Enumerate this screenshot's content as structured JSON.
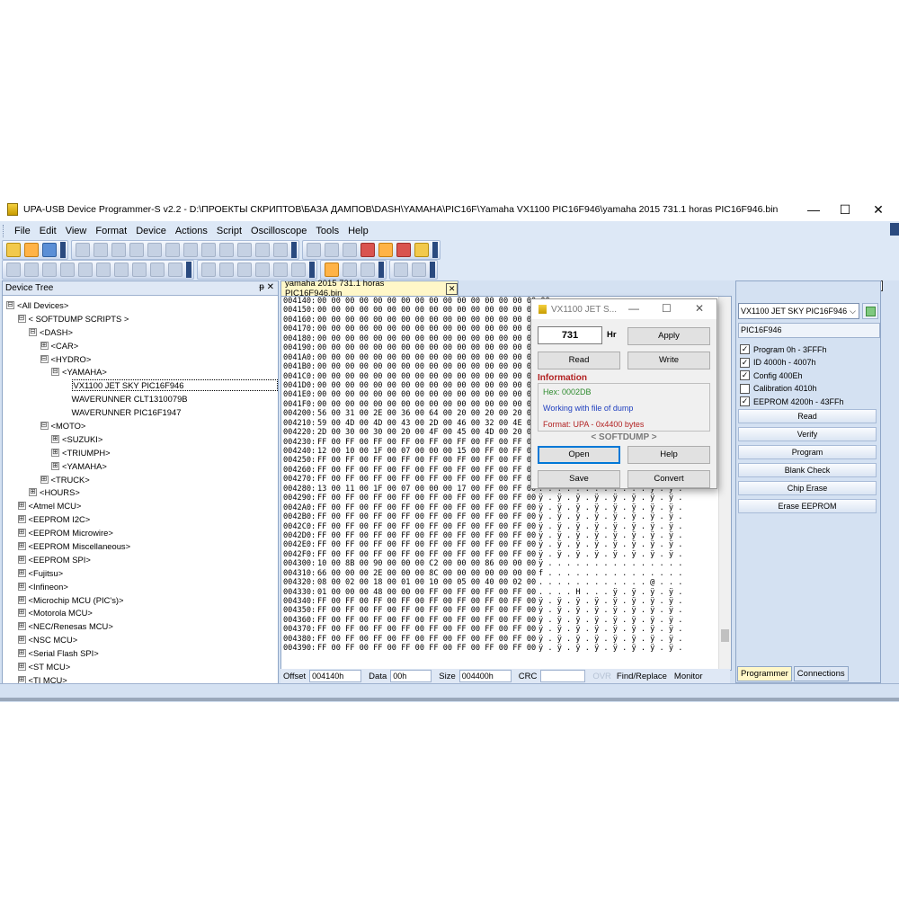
{
  "window": {
    "title": "UPA-USB Device Programmer-S v2.2 - D:\\ПРОЕКТЫ СКРИПТОВ\\БАЗА ДАМПОВ\\DASH\\YAMAHA\\PIC16F\\Yamaha VX1100 PIC16F946\\yamaha 2015 731.1 horas PIC16F946.bin",
    "minimize": "—",
    "maximize": "☐",
    "close": "✕"
  },
  "menu": [
    "File",
    "Edit",
    "View",
    "Format",
    "Device",
    "Actions",
    "Script",
    "Oscilloscope",
    "Tools",
    "Help"
  ],
  "device_tree": {
    "header": "Device Tree",
    "header_buttons": "ᵽ ✕",
    "nodes": [
      {
        "indent": 0,
        "exp": "⊟",
        "label": "<All Devices>"
      },
      {
        "indent": 1,
        "exp": "⊟",
        "label": "< SOFTDUMP SCRIPTS >"
      },
      {
        "indent": 2,
        "exp": "⊟",
        "label": "<DASH>"
      },
      {
        "indent": 3,
        "exp": "⊞",
        "label": "<CAR>"
      },
      {
        "indent": 3,
        "exp": "⊟",
        "label": "<HYDRO>"
      },
      {
        "indent": 4,
        "exp": "⊟",
        "label": "<YAMAHA>"
      },
      {
        "indent": 5,
        "exp": "",
        "label": "VX1100 JET SKY PIC16F946",
        "selected": true
      },
      {
        "indent": 5,
        "exp": "",
        "label": "WAVERUNNER CLT1310079B"
      },
      {
        "indent": 5,
        "exp": "",
        "label": "WAVERUNNER PIC16F1947"
      },
      {
        "indent": 3,
        "exp": "⊟",
        "label": "<MOTO>"
      },
      {
        "indent": 4,
        "exp": "⊞",
        "label": "<SUZUKI>"
      },
      {
        "indent": 4,
        "exp": "⊞",
        "label": "<TRIUMPH>"
      },
      {
        "indent": 4,
        "exp": "⊞",
        "label": "<YAMAHA>"
      },
      {
        "indent": 3,
        "exp": "⊞",
        "label": "<TRUCK>"
      },
      {
        "indent": 2,
        "exp": "⊞",
        "label": "<HOURS>"
      },
      {
        "indent": 1,
        "exp": "⊞",
        "label": "<Atmel MCU>"
      },
      {
        "indent": 1,
        "exp": "⊞",
        "label": "<EEPROM I2C>"
      },
      {
        "indent": 1,
        "exp": "⊞",
        "label": "<EEPROM Microwire>"
      },
      {
        "indent": 1,
        "exp": "⊞",
        "label": "<EEPROM Miscellaneous>"
      },
      {
        "indent": 1,
        "exp": "⊞",
        "label": "<EEPROM SPI>"
      },
      {
        "indent": 1,
        "exp": "⊞",
        "label": "<Fujitsu>"
      },
      {
        "indent": 1,
        "exp": "⊞",
        "label": "<Infineon>"
      },
      {
        "indent": 1,
        "exp": "⊞",
        "label": "<Microchip MCU (PIC's)>"
      },
      {
        "indent": 1,
        "exp": "⊞",
        "label": "<Motorola MCU>"
      },
      {
        "indent": 1,
        "exp": "⊞",
        "label": "<NEC/Renesas MCU>"
      },
      {
        "indent": 1,
        "exp": "⊞",
        "label": "<NSC MCU>"
      },
      {
        "indent": 1,
        "exp": "⊞",
        "label": "<Serial Flash SPI>"
      },
      {
        "indent": 1,
        "exp": "⊞",
        "label": "<ST MCU>"
      },
      {
        "indent": 1,
        "exp": "⊞",
        "label": "<TI MCU>"
      }
    ]
  },
  "editor": {
    "tab": "yamaha 2015 731.1 horas PIC16F946.bin",
    "tab_close": "✕",
    "rows": [
      {
        "addr": "004140:",
        "hex": "00 00 00 00 00 00 00 00 00 00 00 00 00 00 00 00 00",
        "ascii": ""
      },
      {
        "addr": "004150:",
        "hex": "00 00 00 00 00 00 00 00 00 00 00 00 00 00 00 00 00",
        "ascii": ""
      },
      {
        "addr": "004160:",
        "hex": "00 00 00 00 00 00 00 00 00 00 00 00 00 00 00 00 00",
        "ascii": ""
      },
      {
        "addr": "004170:",
        "hex": "00 00 00 00 00 00 00 00 00 00 00 00 00 00 00 00 00",
        "ascii": ""
      },
      {
        "addr": "004180:",
        "hex": "00 00 00 00 00 00 00 00 00 00 00 00 00 00 00 00 00",
        "ascii": ""
      },
      {
        "addr": "004190:",
        "hex": "00 00 00 00 00 00 00 00 00 00 00 00 00 00 00 00 00",
        "ascii": ""
      },
      {
        "addr": "0041A0:",
        "hex": "00 00 00 00 00 00 00 00 00 00 00 00 00 00 00 00 00",
        "ascii": ""
      },
      {
        "addr": "0041B0:",
        "hex": "00 00 00 00 00 00 00 00 00 00 00 00 00 00 00 00 00",
        "ascii": ""
      },
      {
        "addr": "0041C0:",
        "hex": "00 00 00 00 00 00 00 00 00 00 00 00 00 00 00 00 00",
        "ascii": ""
      },
      {
        "addr": "0041D0:",
        "hex": "00 00 00 00 00 00 00 00 00 00 00 00 00 00 00 00 00",
        "ascii": ""
      },
      {
        "addr": "0041E0:",
        "hex": "00 00 00 00 00 00 00 00 00 00 00 00 00 00 00 00 00",
        "ascii": ""
      },
      {
        "addr": "0041F0:",
        "hex": "00 00 00 00 00 00 00 00 00 00 00 00 00 00 00 00 00",
        "ascii": ""
      },
      {
        "addr": "004200:",
        "hex": "56 00 31 00 2E 00 36 00 64 00 20 00 20 00 20 00 20",
        "ascii": ""
      },
      {
        "addr": "004210:",
        "hex": "59 00 4D 00 4D 00 43 00 2D 00 46 00 32 00 4E 00",
        "ascii": ""
      },
      {
        "addr": "004220:",
        "hex": "2D 00 30 00 30 00 20 00 4F 00 45 00 4D 00 20 00",
        "ascii": ""
      },
      {
        "addr": "004230:",
        "hex": "FF 00 FF 00 FF 00 FF 00 FF 00 FF 00 FF 00 FF 00",
        "ascii": ""
      },
      {
        "addr": "004240:",
        "hex": "12 00 10 00 1F 00 07 00 00 00 15 00 FF 00 FF 00",
        "ascii": ""
      },
      {
        "addr": "004250:",
        "hex": "FF 00 FF 00 FF 00 FF 00 FF 00 FF 00 FF 00 FF 00",
        "ascii": ""
      },
      {
        "addr": "004260:",
        "hex": "FF 00 FF 00 FF 00 FF 00 FF 00 FF 00 FF 00 FF 00",
        "ascii": ""
      },
      {
        "addr": "004270:",
        "hex": "FF 00 FF 00 FF 00 FF 00 FF 00 FF 00 FF 00 FF 00",
        "ascii": "ÿ . ÿ . ÿ . ÿ . ÿ . ÿ . ÿ . ÿ ."
      },
      {
        "addr": "004280:",
        "hex": "13 00 11 00 1F 00 07 00 00 00 17 00 FF 00 FF 00",
        "ascii": ". . . . . . . . . . . . ÿ . ÿ ."
      },
      {
        "addr": "004290:",
        "hex": "FF 00 FF 00 FF 00 FF 00 FF 00 FF 00 FF 00 FF 00",
        "ascii": "ÿ . ÿ . ÿ . ÿ . ÿ . ÿ . ÿ . ÿ ."
      },
      {
        "addr": "0042A0:",
        "hex": "FF 00 FF 00 FF 00 FF 00 FF 00 FF 00 FF 00 FF 00",
        "ascii": "ÿ . ÿ . ÿ . ÿ . ÿ . ÿ . ÿ . ÿ ."
      },
      {
        "addr": "0042B0:",
        "hex": "FF 00 FF 00 FF 00 FF 00 FF 00 FF 00 FF 00 FF 00",
        "ascii": "ÿ . ÿ . ÿ . ÿ . ÿ . ÿ . ÿ . ÿ ."
      },
      {
        "addr": "0042C0:",
        "hex": "FF 00 FF 00 FF 00 FF 00 FF 00 FF 00 FF 00 FF 00",
        "ascii": "ÿ . ÿ . ÿ . ÿ . ÿ . ÿ . ÿ . ÿ ."
      },
      {
        "addr": "0042D0:",
        "hex": "FF 00 FF 00 FF 00 FF 00 FF 00 FF 00 FF 00 FF 00",
        "ascii": "ÿ . ÿ . ÿ . ÿ . ÿ . ÿ . ÿ . ÿ ."
      },
      {
        "addr": "0042E0:",
        "hex": "FF 00 FF 00 FF 00 FF 00 FF 00 FF 00 FF 00 FF 00",
        "ascii": "ÿ . ÿ . ÿ . ÿ . ÿ . ÿ . ÿ . ÿ ."
      },
      {
        "addr": "0042F0:",
        "hex": "FF 00 FF 00 FF 00 FF 00 FF 00 FF 00 FF 00 FF 00",
        "ascii": "ÿ . ÿ . ÿ . ÿ . ÿ . ÿ . ÿ . ÿ ."
      },
      {
        "addr": "004300:",
        "hex": "10 00 8B 00 90 00 00 00 C2 00 00 00 86 00 00 00",
        "ascii": "ÿ . . . . . . . . . . . . . . ."
      },
      {
        "addr": "004310:",
        "hex": "66 00 00 00 2E 00 00 00 8C 00 00 00 00 00 00 00",
        "ascii": "f . . . . . . . . . . . . . . ."
      },
      {
        "addr": "004320:",
        "hex": "08 00 02 00 18 00 01 00 10 00 05 00 40 00 02 00",
        "ascii": ". . . . . . . . . . . . @ . . ."
      },
      {
        "addr": "004330:",
        "hex": "01 00 00 00 48 00 00 00 FF 00 FF 00 FF 00 FF 00",
        "ascii": ". . . . H . . . ÿ . ÿ . ÿ . ÿ ."
      },
      {
        "addr": "004340:",
        "hex": "FF 00 FF 00 FF 00 FF 00 FF 00 FF 00 FF 00 FF 00",
        "ascii": "ÿ . ÿ . ÿ . ÿ . ÿ . ÿ . ÿ . ÿ ."
      },
      {
        "addr": "004350:",
        "hex": "FF 00 FF 00 FF 00 FF 00 FF 00 FF 00 FF 00 FF 00",
        "ascii": "ÿ . ÿ . ÿ . ÿ . ÿ . ÿ . ÿ . ÿ ."
      },
      {
        "addr": "004360:",
        "hex": "FF 00 FF 00 FF 00 FF 00 FF 00 FF 00 FF 00 FF 00",
        "ascii": "ÿ . ÿ . ÿ . ÿ . ÿ . ÿ . ÿ . ÿ ."
      },
      {
        "addr": "004370:",
        "hex": "FF 00 FF 00 FF 00 FF 00 FF 00 FF 00 FF 00 FF 00",
        "ascii": "ÿ . ÿ . ÿ . ÿ . ÿ . ÿ . ÿ . ÿ ."
      },
      {
        "addr": "004380:",
        "hex": "FF 00 FF 00 FF 00 FF 00 FF 00 FF 00 FF 00 FF 00",
        "ascii": "ÿ . ÿ . ÿ . ÿ . ÿ . ÿ . ÿ . ÿ ."
      },
      {
        "addr": "004390:",
        "hex": "FF 00 FF 00 FF 00 FF 00 FF 00 FF 00 FF 00 FF 00",
        "ascii": "ÿ . ÿ . ÿ . ÿ . ÿ . ÿ . ÿ . ÿ ."
      }
    ]
  },
  "status": {
    "offset_label": "Offset",
    "offset_value": "004140h",
    "data_label": "Data",
    "data_value": "00h",
    "size_label": "Size",
    "size_value": "004400h",
    "crc_label": "CRC",
    "ovr": "OVR",
    "find_replace": "Find/Replace",
    "monitor": "Monitor"
  },
  "dialog": {
    "title": "VX1100 JET S...",
    "minimize": "—",
    "maximize": "☐",
    "close": "✕",
    "hours_value": "731",
    "hours_unit": "Hr",
    "apply": "Apply",
    "read": "Read",
    "write": "Write",
    "info_header": "Information",
    "info_hex": "Hex: 0002DB",
    "info_status": "Working with file of dump",
    "info_format": "Format: UPA - 0x4400 bytes",
    "softdump": "< SOFTDUMP >",
    "open": "Open",
    "help": "Help",
    "save": "Save",
    "convert": "Convert",
    "colors": {
      "hex": "#2e8b2e",
      "status": "#1f3fbf",
      "format": "#b22222"
    }
  },
  "right_panel": {
    "device_combo": "VX1100 JET SKY PIC16F946",
    "chip": "PIC16F946",
    "checks": [
      {
        "label": "Program 0h - 3FFFh",
        "checked": true
      },
      {
        "label": "ID 4000h - 4007h",
        "checked": true
      },
      {
        "label": "Config 400Eh",
        "checked": true
      },
      {
        "label": "Calibration 4010h",
        "checked": false
      },
      {
        "label": "EEPROM 4200h - 43FFh",
        "checked": true
      }
    ],
    "buttons": [
      "Read",
      "Verify",
      "Program",
      "Blank Check",
      "Chip Erase",
      "Erase EEPROM"
    ],
    "tabs": [
      "Programmer",
      "Connections"
    ]
  }
}
